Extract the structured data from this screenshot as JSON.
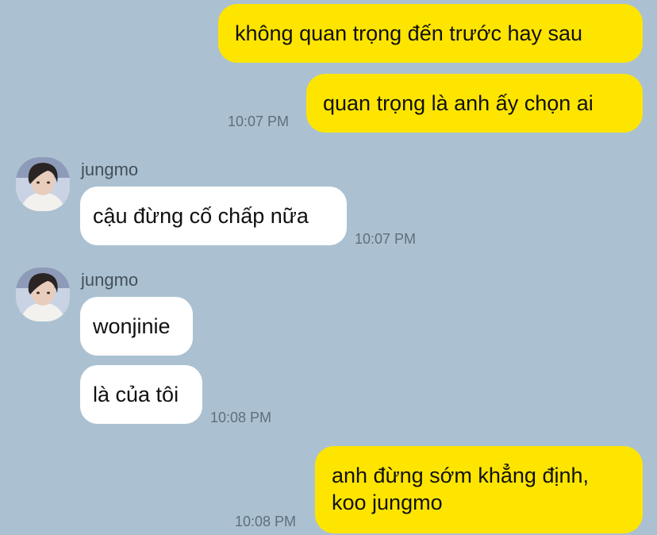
{
  "colors": {
    "background": "#abc1d1",
    "outgoing_bubble": "#fee500",
    "incoming_bubble": "#ffffff",
    "timestamp": "#5e6f7d",
    "sender_name": "#434f58"
  },
  "messages": {
    "m1": {
      "text": "không quan trọng đến trước hay sau"
    },
    "m2": {
      "text": "quan trọng là anh ấy chọn ai",
      "time": "10:07 PM"
    },
    "m3": {
      "sender": "jungmo",
      "text": "cậu đừng cố chấp nữa",
      "time": "10:07 PM"
    },
    "m4": {
      "sender": "jungmo",
      "text": "wonjinie"
    },
    "m5": {
      "text": "là của tôi",
      "time": "10:08 PM"
    },
    "m6": {
      "line1": "anh đừng sớm khẳng định,",
      "line2": "koo jungmo",
      "time": "10:08 PM"
    }
  },
  "avatar": {
    "icon": "user-avatar"
  }
}
